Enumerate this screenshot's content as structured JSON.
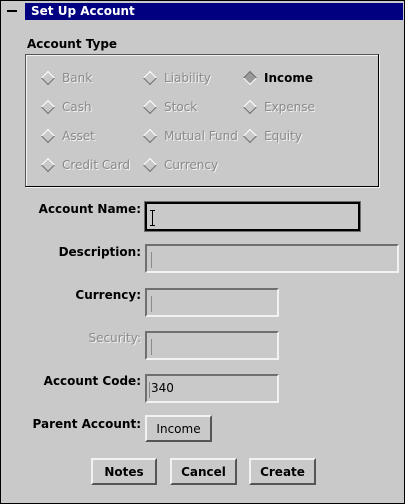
{
  "window": {
    "title": "Set Up Account"
  },
  "account_type": {
    "label": "Account Type",
    "options": [
      {
        "label": "Bank",
        "selected": false
      },
      {
        "label": "Liability",
        "selected": false
      },
      {
        "label": "Income",
        "selected": true
      },
      {
        "label": "Cash",
        "selected": false
      },
      {
        "label": "Stock",
        "selected": false
      },
      {
        "label": "Expense",
        "selected": false
      },
      {
        "label": "Asset",
        "selected": false
      },
      {
        "label": "Mutual Fund",
        "selected": false
      },
      {
        "label": "Equity",
        "selected": false
      },
      {
        "label": "Credit Card",
        "selected": false
      },
      {
        "label": "Currency",
        "selected": false
      }
    ]
  },
  "form": {
    "account_name": {
      "label": "Account Name:",
      "value": ""
    },
    "description": {
      "label": "Description:",
      "value": ""
    },
    "currency": {
      "label": "Currency:",
      "value": ""
    },
    "security": {
      "label": "Security:",
      "value": ""
    },
    "account_code": {
      "label": "Account Code:",
      "value": "340"
    },
    "parent_account": {
      "label": "Parent Account:",
      "value": "Income"
    }
  },
  "buttons": {
    "notes": "Notes",
    "cancel": "Cancel",
    "create": "Create"
  }
}
